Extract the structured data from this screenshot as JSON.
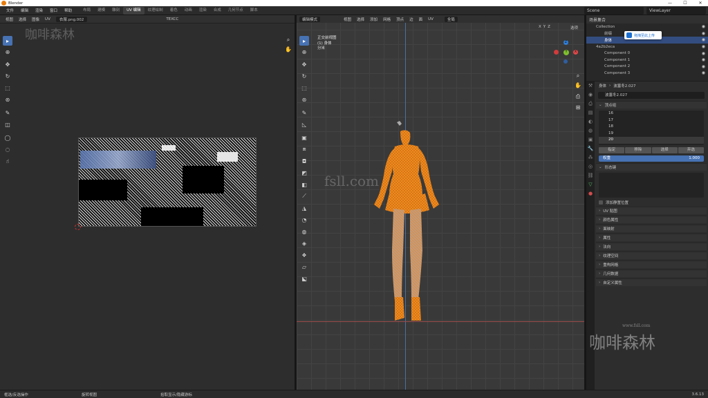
{
  "titlebar": {
    "app_title": "Blender",
    "minimize": "—",
    "maximize": "☐",
    "close": "✕"
  },
  "topbar": {
    "menus": [
      "文件",
      "编辑",
      "渲染",
      "窗口",
      "帮助"
    ],
    "workspaces": [
      "布局",
      "建模",
      "雕刻",
      "UV 编辑",
      "纹理绘制",
      "着色",
      "动画",
      "渲染",
      "合成",
      "几何节点",
      "脚本"
    ],
    "active_workspace": "UV 编辑",
    "scene_label": "Scene",
    "viewlayer_label": "ViewLayer"
  },
  "uv_editor": {
    "header_items": [
      "视图",
      "选择",
      "图像",
      "UV"
    ],
    "image_name": "衣服.png.002",
    "texcoord_label": "TEXCC"
  },
  "viewport": {
    "mode": "编辑模式",
    "header_items": [
      "视图",
      "选择",
      "添加",
      "网格",
      "顶点",
      "边",
      "面",
      "UV"
    ],
    "transform": "全局",
    "options_label": "选项",
    "axis_buttons": [
      "X",
      "Y",
      "Z"
    ],
    "info_lines": [
      "正交前视图",
      "(1) 身体",
      "分米"
    ],
    "gizmo": {
      "x": "X",
      "y": "Y",
      "z": "Z"
    }
  },
  "outliner": {
    "header_label": "场景集合",
    "rows": [
      {
        "label": "Collection",
        "selected": false
      },
      {
        "label": "前缀",
        "selected": false
      },
      {
        "label": "身体",
        "selected": true
      },
      {
        "label": "4a2b2eca",
        "selected": false
      },
      {
        "label": "Component 0",
        "selected": false
      },
      {
        "label": "Component 1",
        "selected": false
      },
      {
        "label": "Component 2",
        "selected": false
      },
      {
        "label": "Component 3",
        "selected": false
      }
    ],
    "tooltip": "拖拽至此上传"
  },
  "properties": {
    "breadcrumb_object": "身体",
    "breadcrumb_mesh": "波塞冬2.027",
    "mesh_name": "波塞冬2.027",
    "vertex_groups_title": "顶点组",
    "vertex_groups": [
      "16",
      "17",
      "18",
      "19",
      "20"
    ],
    "selected_group": "20",
    "vg_buttons": [
      "指定",
      "移除",
      "选择",
      "弃选"
    ],
    "weight_label": "权重",
    "weight_value": "1.000",
    "shape_keys_title": "形态键",
    "checkbox_label": "添加静置位置",
    "sections": [
      "UV 贴图",
      "颜色属性",
      "面映射",
      "属性",
      "法向",
      "纹理空间",
      "重构网格",
      "几何数据",
      "自定义属性"
    ]
  },
  "statusbar": {
    "left": "框选/反选操作",
    "middle": "旋转视图",
    "right": "拾取显示/隐藏游标",
    "version": "3.6.13"
  },
  "watermarks": {
    "top_left": "咖啡森林",
    "site_url": "www.fsll.com",
    "mid_text": "fsll.com",
    "logo_text": "咖啡森林"
  },
  "colors": {
    "accent": "#4772b3",
    "mesh": "#f08a1e",
    "selection": "#334d80"
  }
}
